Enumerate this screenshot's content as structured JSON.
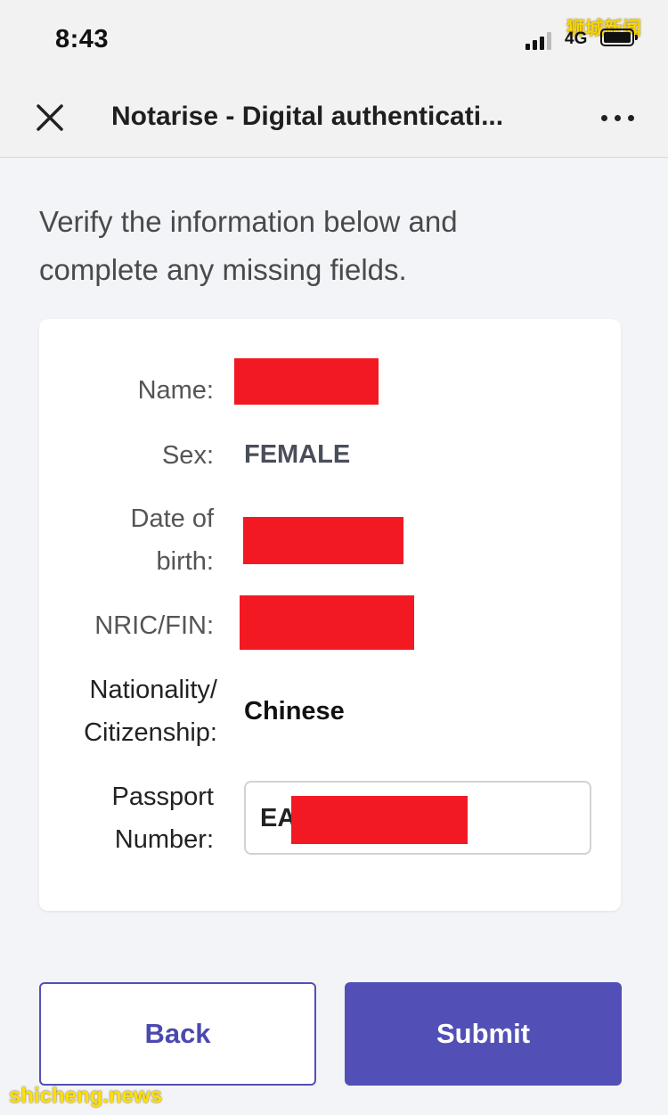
{
  "status_bar": {
    "time": "8:43",
    "network": "4G",
    "watermark": "狮城新闻"
  },
  "nav": {
    "title": "Notarise - Digital authenticati...",
    "close_icon": "close-icon",
    "more_icon": "more-horizontal-icon"
  },
  "intro_text": "Verify the information below and complete any missing fields.",
  "form": {
    "name_label": "Name:",
    "sex_label": "Sex:",
    "sex_value": "FEMALE",
    "dob_label_1": "Date of",
    "dob_label_2": "birth:",
    "nric_label": "NRIC/FIN:",
    "nationality_label_1": "Nationality/",
    "nationality_label_2": "Citizenship:",
    "nationality_value": "Chinese",
    "passport_label_1": "Passport",
    "passport_label_2": "Number:",
    "passport_value_prefix": "EA"
  },
  "buttons": {
    "back": "Back",
    "submit": "Submit"
  },
  "footer_watermark": "shicheng.news",
  "colors": {
    "accent": "#5250b6",
    "redaction": "#f21923",
    "watermark": "#ffe100"
  }
}
